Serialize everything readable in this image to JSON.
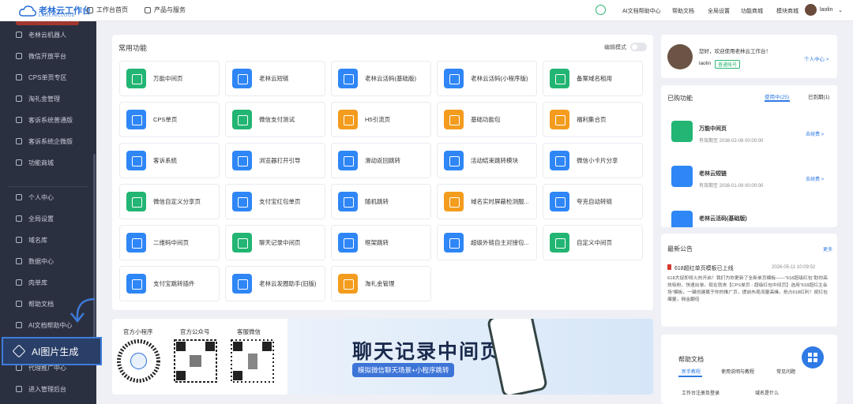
{
  "brand": {
    "name": "老林云工作台",
    "sub": "LAOLINCLOUD"
  },
  "topnav": {
    "home": "工作台首页",
    "products": "产品与服务",
    "ai_doc": "AI文档帮助中心",
    "help": "帮助文档",
    "settings": "全局设置",
    "mall": "功能商城",
    "module": "模块商城",
    "user": "laolin"
  },
  "sidebar": {
    "items": [
      "老林云机器人",
      "微信开放平台",
      "CPS单页专区",
      "淘礼金管理",
      "客诉系统普通版",
      "客诉系统企微版",
      "功能商城",
      "个人中心",
      "全局设置",
      "域名库",
      "数据中心",
      "肉单库",
      "帮助文档",
      "AI文档帮助中心",
      "AI图片生成",
      "代理推广中心",
      "进入管理后台"
    ],
    "selected": "AI图片生成"
  },
  "common": {
    "title": "常用功能",
    "edit": "编辑模式",
    "cards": [
      {
        "label": "万能中间页",
        "color": "#22b573"
      },
      {
        "label": "老林云短链",
        "color": "#2f86f6"
      },
      {
        "label": "老林云活码(基础版)",
        "color": "#2f86f6"
      },
      {
        "label": "老林云活码(小程序版)",
        "color": "#2f86f6"
      },
      {
        "label": "备案域名租用",
        "color": "#22b573"
      },
      {
        "label": "CPS单页",
        "color": "#2f86f6"
      },
      {
        "label": "微信支付测试",
        "color": "#22b573"
      },
      {
        "label": "H5引流页",
        "color": "#f39c1e"
      },
      {
        "label": "基础功能包",
        "color": "#f39c1e"
      },
      {
        "label": "福利集合页",
        "color": "#f39c1e"
      },
      {
        "label": "客诉系统",
        "color": "#2f86f6"
      },
      {
        "label": "浏览器打开引导",
        "color": "#2f86f6"
      },
      {
        "label": "滑动返回跳转",
        "color": "#2f86f6"
      },
      {
        "label": "活动结束跳转模块",
        "color": "#2f86f6"
      },
      {
        "label": "微信小卡片分享",
        "color": "#2f86f6"
      },
      {
        "label": "微信自定义分享页",
        "color": "#22b573"
      },
      {
        "label": "支付宝红包单页",
        "color": "#2f86f6"
      },
      {
        "label": "随机跳转",
        "color": "#2f86f6"
      },
      {
        "label": "域名实时屏蔽检测服...",
        "color": "#f39c1e"
      },
      {
        "label": "夸克自动转链",
        "color": "#2f86f6"
      },
      {
        "label": "二维码中间页",
        "color": "#2f86f6"
      },
      {
        "label": "聊天记录中间页",
        "color": "#22b573"
      },
      {
        "label": "框架跳转",
        "color": "#2f86f6"
      },
      {
        "label": "超级外链自主对接包...",
        "color": "#2f86f6"
      },
      {
        "label": "自定义中间页",
        "color": "#22b573"
      },
      {
        "label": "支付宝跳转插件",
        "color": "#2f86f6"
      },
      {
        "label": "老林云发圈助手(旧版)",
        "color": "#2f86f6"
      },
      {
        "label": "淘礼金管理",
        "color": "#f39c1e"
      }
    ]
  },
  "qrcodes": [
    "官方小程序",
    "官方公众号",
    "客服微信"
  ],
  "banner": {
    "title": "聊天记录中间页",
    "subtitle": "模拟微信聊天场景+小程序跳转"
  },
  "welcome": {
    "text": "您好，欢迎使用老林云工作台！",
    "name": "laolin",
    "badge": "普通账号",
    "link": "个人中心 >"
  },
  "purchased": {
    "title": "已购功能",
    "tab1": "使用中(25)",
    "tab2": "已到期(1)",
    "items": [
      {
        "name": "万能中间页",
        "date": "有效期至 2038-02-08 00:00:00",
        "action": "去续费 >",
        "color": "#22b573"
      },
      {
        "name": "老林云短链",
        "date": "有效期至 2038-01-09 00:00:00",
        "action": "去续费 >",
        "color": "#2f86f6"
      },
      {
        "name": "老林云活码(基础版)",
        "date": "",
        "action": "",
        "color": "#2f86f6"
      }
    ]
  },
  "notice": {
    "title": "最新公告",
    "more": "更多",
    "head": "618超红单页模板已上线",
    "time": "2026-05-11 10:09:52",
    "body": "618大促即将火热开启！我们为你更新了全新单页模板——“618超级红包”助你高效吸粉，快速出单。现在就去【CPS单页 - 超级红包中间页】选用“618超红主会场”模板，一键创建属于你的推广页，提前布局流量高峰，抢占618红利！祝红包爆量，佣金翻倍"
  },
  "help": {
    "title": "帮助文档",
    "tabs": [
      "新手教程",
      "使用说明与教程",
      "常见问题"
    ],
    "links": [
      "工作台注册及登录",
      "域名是什么"
    ]
  }
}
